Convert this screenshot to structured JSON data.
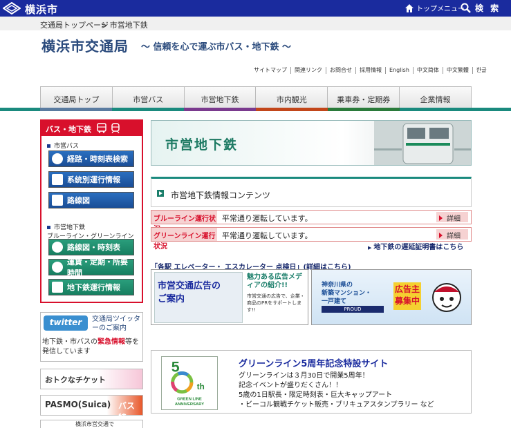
{
  "header": {
    "site_name": "横浜市",
    "top_menu_label": "トップメニュー",
    "search_label": "検 索"
  },
  "breadcrumb": {
    "items": [
      "交通局トップページ",
      "> 市営地下鉄"
    ]
  },
  "page": {
    "title": "横浜市交通局",
    "tagline": "～ 信頼を心で運ぶ市バス・地下鉄 ～"
  },
  "utility_links": [
    "サイトマップ",
    "関連リンク",
    "お問合せ",
    "採用情報",
    "English",
    "中文简体",
    "中文繁體",
    "한글"
  ],
  "nav": {
    "items": [
      "交通局トップ",
      "市営バス",
      "市営地下鉄",
      "市内観光",
      "乗車券・定期券",
      "企業情報"
    ],
    "stripe_colors": [
      "#5a7ba0",
      "#1a8a7e",
      "#7a3a8e",
      "#c2461a",
      "#2a7a3a",
      "#1a8a7e"
    ]
  },
  "sidebar": {
    "header": "バス・地下鉄",
    "bus_section": "市営バス",
    "bus_buttons": [
      "経路・時刻表検索",
      "系統別運行情報",
      "路線図"
    ],
    "subway_section": "市営地下鉄",
    "subway_note": "ブルーライン・グリーンライン",
    "subway_buttons": [
      "路線図・時刻表",
      "運賃・定期・所要時間",
      "地下鉄運行情報"
    ]
  },
  "twitter": {
    "logo_text": "twitter",
    "label": "交通局ツイッターのご案内",
    "desc_prefix": "地下鉄・市バスの",
    "desc_emphasis": "緊急情報",
    "desc_suffix": "等を発信しています"
  },
  "banners": {
    "ticket": "おトクなチケット",
    "pasmo": "PASMO(Suica)",
    "pasmo_tag": "バス特",
    "bottom": "横浜市営交通で"
  },
  "main": {
    "heading": "市営地下鉄",
    "info_title": "市営地下鉄情報コンテンツ",
    "blue_label": "ブルーライン運行状況",
    "blue_status": "平常通り運転しています。",
    "green_label": "グリーンライン運行状況",
    "green_status": "平常通り運転しています。",
    "detail_label": "詳細",
    "delay_link": "地下鉄の遅延証明書はこちら",
    "elevator_link": "「各駅 エレベーター・ エスカレーター 点検日」(詳細はこちら)"
  },
  "ad_banner": {
    "line1": "市営交通広告の",
    "line2": "ご案内",
    "head": "魅力ある広告メディアの紹介!!",
    "body": "市営交通の広告で、企業・商品のPRをサポートします!!"
  },
  "property_banner": {
    "line1": "神奈川県の",
    "line2": "新築マンション・",
    "line3": "一戸建て",
    "proud": "PROUD",
    "recruit1": "広告主",
    "recruit2": "募集中"
  },
  "anniversary": {
    "title": "グリーンライン5周年記念特設サイト",
    "lines": [
      "グリーンラインは３月30日で開業5周年！",
      "記念イベントが盛りだくさん！！",
      "5歳の1日駅長・限定時刻表・巨大キャップアート",
      "・ビーコル観戦チケット販売・ブリキュアスタンプラリー など"
    ],
    "logo_num": "5",
    "logo_th": "th",
    "logo_line1": "GREEN LINE",
    "logo_line2": "ANNIVERSARY"
  }
}
